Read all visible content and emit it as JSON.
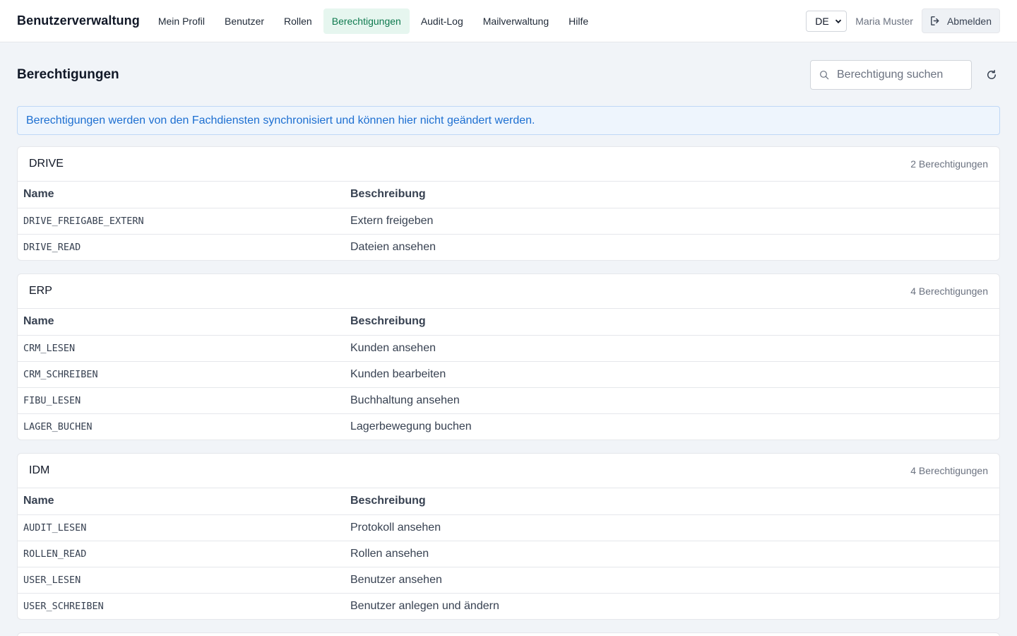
{
  "app": {
    "title": "Benutzerverwaltung"
  },
  "nav": {
    "items": [
      {
        "label": "Mein Profil",
        "active": false
      },
      {
        "label": "Benutzer",
        "active": false
      },
      {
        "label": "Rollen",
        "active": false
      },
      {
        "label": "Berechtigungen",
        "active": true
      },
      {
        "label": "Audit-Log",
        "active": false
      },
      {
        "label": "Mailverwaltung",
        "active": false
      },
      {
        "label": "Hilfe",
        "active": false
      }
    ]
  },
  "header": {
    "language": "DE",
    "user": "Maria Muster",
    "logout_label": "Abmelden"
  },
  "page": {
    "title": "Berechtigungen",
    "search_placeholder": "Berechtigung suchen",
    "info": "Berechtigungen werden von den Fachdiensten synchronisiert und können hier nicht geändert werden."
  },
  "table_headers": {
    "name": "Name",
    "description": "Beschreibung"
  },
  "groups": [
    {
      "title": "DRIVE",
      "count": "2 Berechtigungen",
      "rows": [
        {
          "name": "DRIVE_FREIGABE_EXTERN",
          "description": "Extern freigeben"
        },
        {
          "name": "DRIVE_READ",
          "description": "Dateien ansehen"
        }
      ]
    },
    {
      "title": "ERP",
      "count": "4 Berechtigungen",
      "rows": [
        {
          "name": "CRM_LESEN",
          "description": "Kunden ansehen"
        },
        {
          "name": "CRM_SCHREIBEN",
          "description": "Kunden bearbeiten"
        },
        {
          "name": "FIBU_LESEN",
          "description": "Buchhaltung ansehen"
        },
        {
          "name": "LAGER_BUCHEN",
          "description": "Lagerbewegung buchen"
        }
      ]
    },
    {
      "title": "IDM",
      "count": "4 Berechtigungen",
      "rows": [
        {
          "name": "AUDIT_LESEN",
          "description": "Protokoll ansehen"
        },
        {
          "name": "ROLLEN_READ",
          "description": "Rollen ansehen"
        },
        {
          "name": "USER_LESEN",
          "description": "Benutzer ansehen"
        },
        {
          "name": "USER_SCHREIBEN",
          "description": "Benutzer anlegen und ändern"
        }
      ]
    }
  ],
  "colors": {
    "accent": "#0f7a4f",
    "accent_bg": "#e6f6ef",
    "info_text": "#1d6fd1",
    "info_bg": "#eef5fd"
  }
}
